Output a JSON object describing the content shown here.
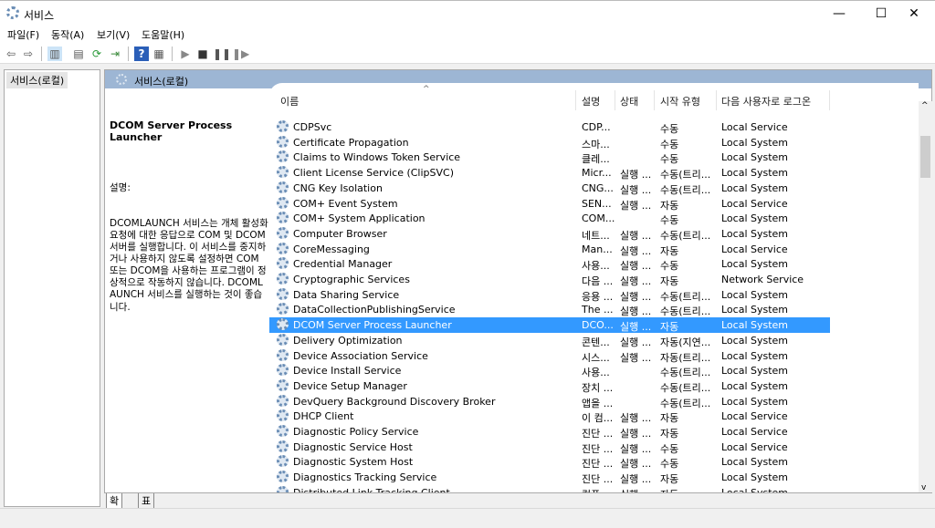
{
  "window": {
    "title": "서비스",
    "minimize": "—",
    "maximize": "☐",
    "close": "✕"
  },
  "menu": [
    "파일(F)",
    "동작(A)",
    "보기(V)",
    "도움말(H)"
  ],
  "toolbar": [
    "back-icon",
    "forward-icon",
    "show-hide-console-tree-icon",
    "properties-icon",
    "refresh-icon",
    "export-list-icon",
    "help-icon",
    "action-pane-icon",
    "start-icon",
    "stop-icon",
    "pause-icon",
    "resume-icon"
  ],
  "tree": {
    "item": "서비스(로컬)"
  },
  "panel": {
    "title": "서비스(로컬)"
  },
  "detail": {
    "name": "DCOM Server Process Launcher",
    "label": "설명:",
    "text": "DCOMLAUNCH 서비스는 개체 활성화 요청에 대한 응답으로 COM 및 DCOM 서버를 실행합니다. 이 서비스를 중지하거나 사용하지 않도록 설정하면 COM 또는 DCOM을 사용하는 프로그램이 정상적으로 작동하지 않습니다. DCOMLAUNCH 서비스를 실행하는 것이 좋습니다."
  },
  "columns": [
    "이름",
    "설명",
    "상태",
    "시작 유형",
    "다음 사용자로 로그온"
  ],
  "accent": "#3399ff",
  "rows": [
    [
      "CDPSvc",
      "CDP...",
      "",
      "수동",
      "Local Service"
    ],
    [
      "Certificate Propagation",
      "스마...",
      "",
      "수동",
      "Local System"
    ],
    [
      "Claims to Windows Token Service",
      "클레...",
      "",
      "수동",
      "Local System"
    ],
    [
      "Client License Service (ClipSVC)",
      "Micr...",
      "실행 ...",
      "수동(트리...",
      "Local System"
    ],
    [
      "CNG Key Isolation",
      "CNG...",
      "실행 ...",
      "수동(트리...",
      "Local System"
    ],
    [
      "COM+ Event System",
      "SEN...",
      "실행 ...",
      "자동",
      "Local Service"
    ],
    [
      "COM+ System Application",
      "COM...",
      "",
      "수동",
      "Local System"
    ],
    [
      "Computer Browser",
      "네트...",
      "실행 ...",
      "수동(트리...",
      "Local System"
    ],
    [
      "CoreMessaging",
      "Man...",
      "실행 ...",
      "자동",
      "Local Service"
    ],
    [
      "Credential Manager",
      "사용...",
      "실행 ...",
      "수동",
      "Local System"
    ],
    [
      "Cryptographic Services",
      "다음 ...",
      "실행 ...",
      "자동",
      "Network Service"
    ],
    [
      "Data Sharing Service",
      "응용 ...",
      "실행 ...",
      "수동(트리...",
      "Local System"
    ],
    [
      "DataCollectionPublishingService",
      "The ...",
      "실행 ...",
      "수동(트리...",
      "Local System"
    ],
    [
      "DCOM Server Process Launcher",
      "DCO...",
      "실행 ...",
      "자동",
      "Local System"
    ],
    [
      "Delivery Optimization",
      "콘텐...",
      "실행 ...",
      "자동(지연...",
      "Local System"
    ],
    [
      "Device Association Service",
      "시스...",
      "실행 ...",
      "자동(트리...",
      "Local System"
    ],
    [
      "Device Install Service",
      "사용...",
      "",
      "수동(트리...",
      "Local System"
    ],
    [
      "Device Setup Manager",
      "장치 ...",
      "",
      "수동(트리...",
      "Local System"
    ],
    [
      "DevQuery Background Discovery Broker",
      "앱을 ...",
      "",
      "수동(트리...",
      "Local System"
    ],
    [
      "DHCP Client",
      "이 컴...",
      "실행 ...",
      "자동",
      "Local Service"
    ],
    [
      "Diagnostic Policy Service",
      "진단 ...",
      "실행 ...",
      "자동",
      "Local Service"
    ],
    [
      "Diagnostic Service Host",
      "진단 ...",
      "실행 ...",
      "수동",
      "Local Service"
    ],
    [
      "Diagnostic System Host",
      "진단 ...",
      "실행 ...",
      "수동",
      "Local System"
    ],
    [
      "Diagnostics Tracking Service",
      "진단 ...",
      "실행 ...",
      "자동",
      "Local System"
    ],
    [
      "Distributed Link Tracking Client",
      "컴퓨...",
      "실행 ...",
      "자동",
      "Local System"
    ]
  ],
  "selected_index": 13,
  "tabs": [
    "확장",
    "표준"
  ]
}
